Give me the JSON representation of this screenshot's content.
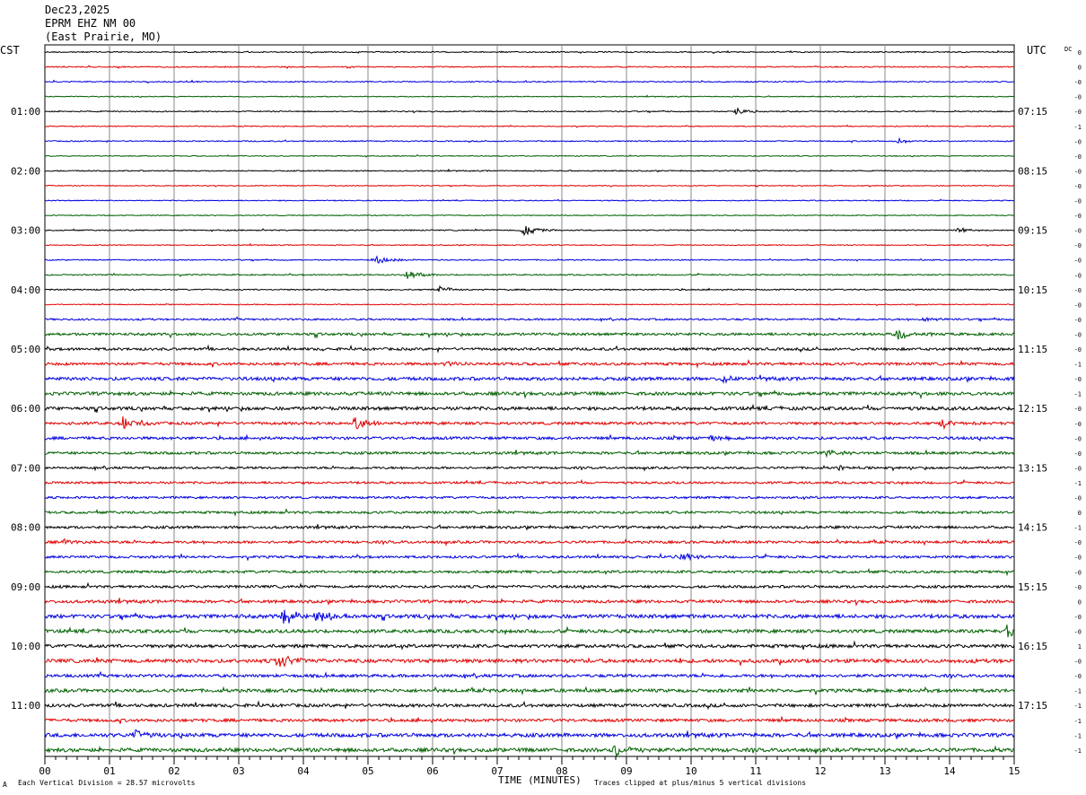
{
  "header": {
    "date": "Dec23,2025",
    "station": "EPRM EHZ NM 00",
    "location": "(East Prairie, MO)"
  },
  "left_tz": "CST",
  "right_tz": "UTC",
  "dc_label": "DC",
  "footer": {
    "left": "Each Vertical Division =   28.57 microvolts",
    "center": "TIME (MINUTES)",
    "right": "Traces clipped at plus/minus 5 vertical divisions",
    "corner_mark": "A"
  },
  "chart_data": {
    "type": "line",
    "title": "",
    "xlabel": "TIME (MINUTES)",
    "ylabel": "",
    "x_ticks": [
      "00",
      "01",
      "02",
      "03",
      "04",
      "05",
      "06",
      "07",
      "08",
      "09",
      "10",
      "11",
      "12",
      "13",
      "14",
      "15"
    ],
    "xlim": [
      0,
      15
    ],
    "grid": true,
    "trace_colors": [
      "#000000",
      "#e00000",
      "#0000e0",
      "#006000"
    ],
    "left_hour_labels": [
      "01:00",
      "02:00",
      "03:00",
      "04:00",
      "05:00",
      "06:00",
      "07:00",
      "08:00",
      "09:00",
      "10:00",
      "11:00"
    ],
    "right_hour_labels": [
      "07:15",
      "08:15",
      "09:15",
      "10:15",
      "11:15",
      "12:15",
      "13:15",
      "14:15",
      "15:15",
      "16:15",
      "17:15"
    ],
    "dc_offsets": [
      "0",
      "0",
      "-0",
      "-0",
      "-0",
      "-1",
      "-0",
      "-0",
      "-0",
      "-0",
      "-0",
      "-0",
      "-0",
      "-0",
      "-0",
      "-0",
      "-0",
      "-0",
      "-0",
      "-0",
      "-0",
      "-1",
      "-0",
      "-1",
      "-0",
      "-0",
      "-0",
      "-0",
      "-0",
      "-1",
      "-0",
      "0",
      "-1",
      "-0",
      "-0",
      "-0",
      "-0",
      "0",
      "-0",
      "-0",
      "1",
      "-0",
      "-0",
      "-1",
      "-1",
      "-1",
      "-1",
      "-1"
    ],
    "noise_levels": [
      0.6,
      0.6,
      0.6,
      0.5,
      0.6,
      0.5,
      0.6,
      0.5,
      0.6,
      0.5,
      0.5,
      0.5,
      0.6,
      0.5,
      0.6,
      0.7,
      0.7,
      0.5,
      1.0,
      1.4,
      1.4,
      1.5,
      1.8,
      1.8,
      1.8,
      1.5,
      1.5,
      1.4,
      1.2,
      1.2,
      1.2,
      1.3,
      1.4,
      1.4,
      1.3,
      1.4,
      1.4,
      1.6,
      2.0,
      1.8,
      1.8,
      2.0,
      1.6,
      1.8,
      1.7,
      1.6,
      2.0,
      2.0
    ],
    "events": [
      {
        "trace": 4,
        "minute": 10.7,
        "amp": 4
      },
      {
        "trace": 6,
        "minute": 13.2,
        "amp": 3
      },
      {
        "trace": 12,
        "minute": 14.1,
        "amp": 3
      },
      {
        "trace": 12,
        "minute": 7.4,
        "amp": 6
      },
      {
        "trace": 14,
        "minute": 5.1,
        "amp": 5
      },
      {
        "trace": 15,
        "minute": 5.6,
        "amp": 5
      },
      {
        "trace": 16,
        "minute": 6.1,
        "amp": 4
      },
      {
        "trace": 18,
        "minute": 13.6,
        "amp": 3
      },
      {
        "trace": 19,
        "minute": 13.2,
        "amp": 7
      },
      {
        "trace": 21,
        "minute": 6.2,
        "amp": 4
      },
      {
        "trace": 22,
        "minute": 10.5,
        "amp": 4
      },
      {
        "trace": 25,
        "minute": 1.2,
        "amp": 8
      },
      {
        "trace": 25,
        "minute": 4.8,
        "amp": 8
      },
      {
        "trace": 25,
        "minute": 13.9,
        "amp": 5
      },
      {
        "trace": 26,
        "minute": 10.3,
        "amp": 4
      },
      {
        "trace": 27,
        "minute": 12.1,
        "amp": 4
      },
      {
        "trace": 28,
        "minute": 12.3,
        "amp": 3
      },
      {
        "trace": 33,
        "minute": 0.3,
        "amp": 3
      },
      {
        "trace": 34,
        "minute": 9.8,
        "amp": 5
      },
      {
        "trace": 38,
        "minute": 3.7,
        "amp": 9
      },
      {
        "trace": 38,
        "minute": 4.2,
        "amp": 9
      },
      {
        "trace": 39,
        "minute": 14.9,
        "amp": 8
      },
      {
        "trace": 41,
        "minute": 3.6,
        "amp": 9
      },
      {
        "trace": 46,
        "minute": 1.4,
        "amp": 5
      },
      {
        "trace": 47,
        "minute": 8.8,
        "amp": 8
      }
    ]
  }
}
